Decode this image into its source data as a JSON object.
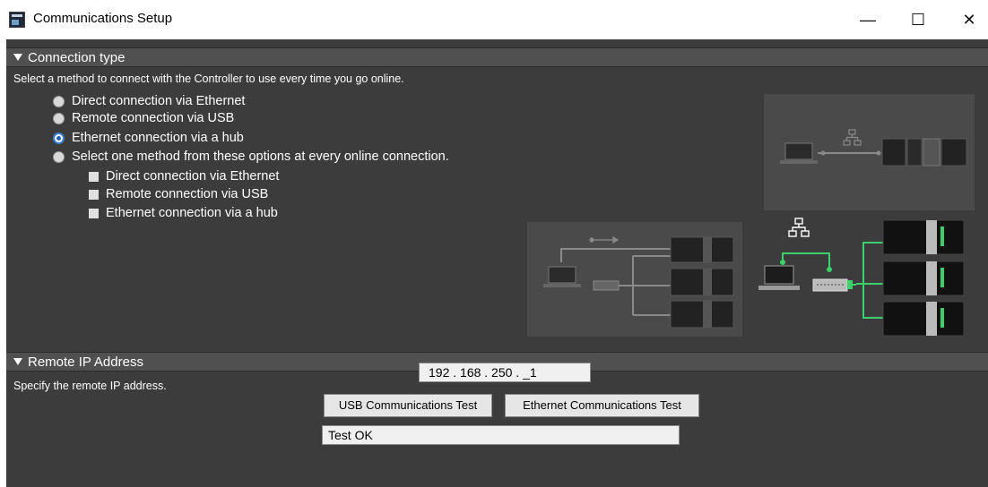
{
  "window": {
    "title": "Communications Setup",
    "minimize_glyph": "—",
    "maximize_glyph": "☐",
    "close_glyph": "✕"
  },
  "connection_type": {
    "header": "Connection type",
    "description": "Select a method to connect with the Controller to use every time you go online.",
    "options": [
      {
        "label": "Direct connection via Ethernet",
        "selected": false
      },
      {
        "label": "Remote connection via USB",
        "selected": false
      },
      {
        "label": "Ethernet connection via a hub",
        "selected": true
      },
      {
        "label": "Select one method from these options at every online connection.",
        "selected": false
      }
    ],
    "sub_options": [
      {
        "label": "Direct connection via Ethernet",
        "checked": false
      },
      {
        "label": "Remote connection via USB",
        "checked": false
      },
      {
        "label": "Ethernet connection via a hub",
        "checked": false
      }
    ]
  },
  "remote_ip": {
    "header": "Remote IP Address",
    "description": "Specify the remote IP address.",
    "ip_value": "192 . 168 . 250 . _1",
    "usb_test_label": "USB Communications Test",
    "ethernet_test_label": "Ethernet Communications Test",
    "status_text": "Test OK"
  },
  "diagram": {
    "icons": [
      "network-hub-icon",
      "usb-icon",
      "laptop-icon",
      "switch-icon",
      "controller-rack-icon"
    ],
    "colors": {
      "active_link": "#3bd06a",
      "inactive_link": "#8a8a8a",
      "panel_bg": "#4a4a4a"
    }
  }
}
